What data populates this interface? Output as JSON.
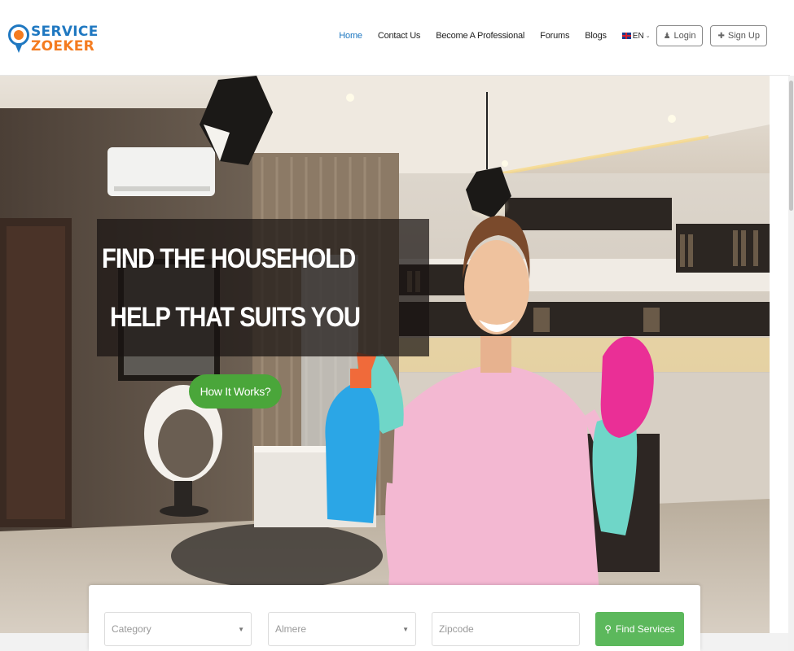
{
  "brand": {
    "line1": "SERVICE",
    "line2": "ZOEKER"
  },
  "nav": {
    "items": [
      {
        "label": "Home",
        "active": true
      },
      {
        "label": "Contact Us",
        "active": false
      },
      {
        "label": "Become A Professional",
        "active": false
      },
      {
        "label": "Forums",
        "active": false
      },
      {
        "label": "Blogs",
        "active": false
      }
    ],
    "language": "EN",
    "login_label": "Login",
    "signup_label": "Sign Up"
  },
  "hero": {
    "headline_line1": "FIND THE HOUSEHOLD",
    "headline_line2": "HELP THAT SUITS YOU",
    "cta_label": "How It Works?"
  },
  "search": {
    "category_placeholder": "Category",
    "city_value": "Almere",
    "zipcode_placeholder": "Zipcode",
    "button_label": "Find Services"
  },
  "colors": {
    "brand_blue": "#1f78c1",
    "brand_orange": "#f47c20",
    "cta_green": "#4aa63a",
    "button_green": "#5cb85c"
  },
  "icons": {
    "logo": "location-pin-icon",
    "login": "user-icon",
    "signup": "plus-icon",
    "search": "search-icon",
    "flag": "uk-flag-icon"
  }
}
